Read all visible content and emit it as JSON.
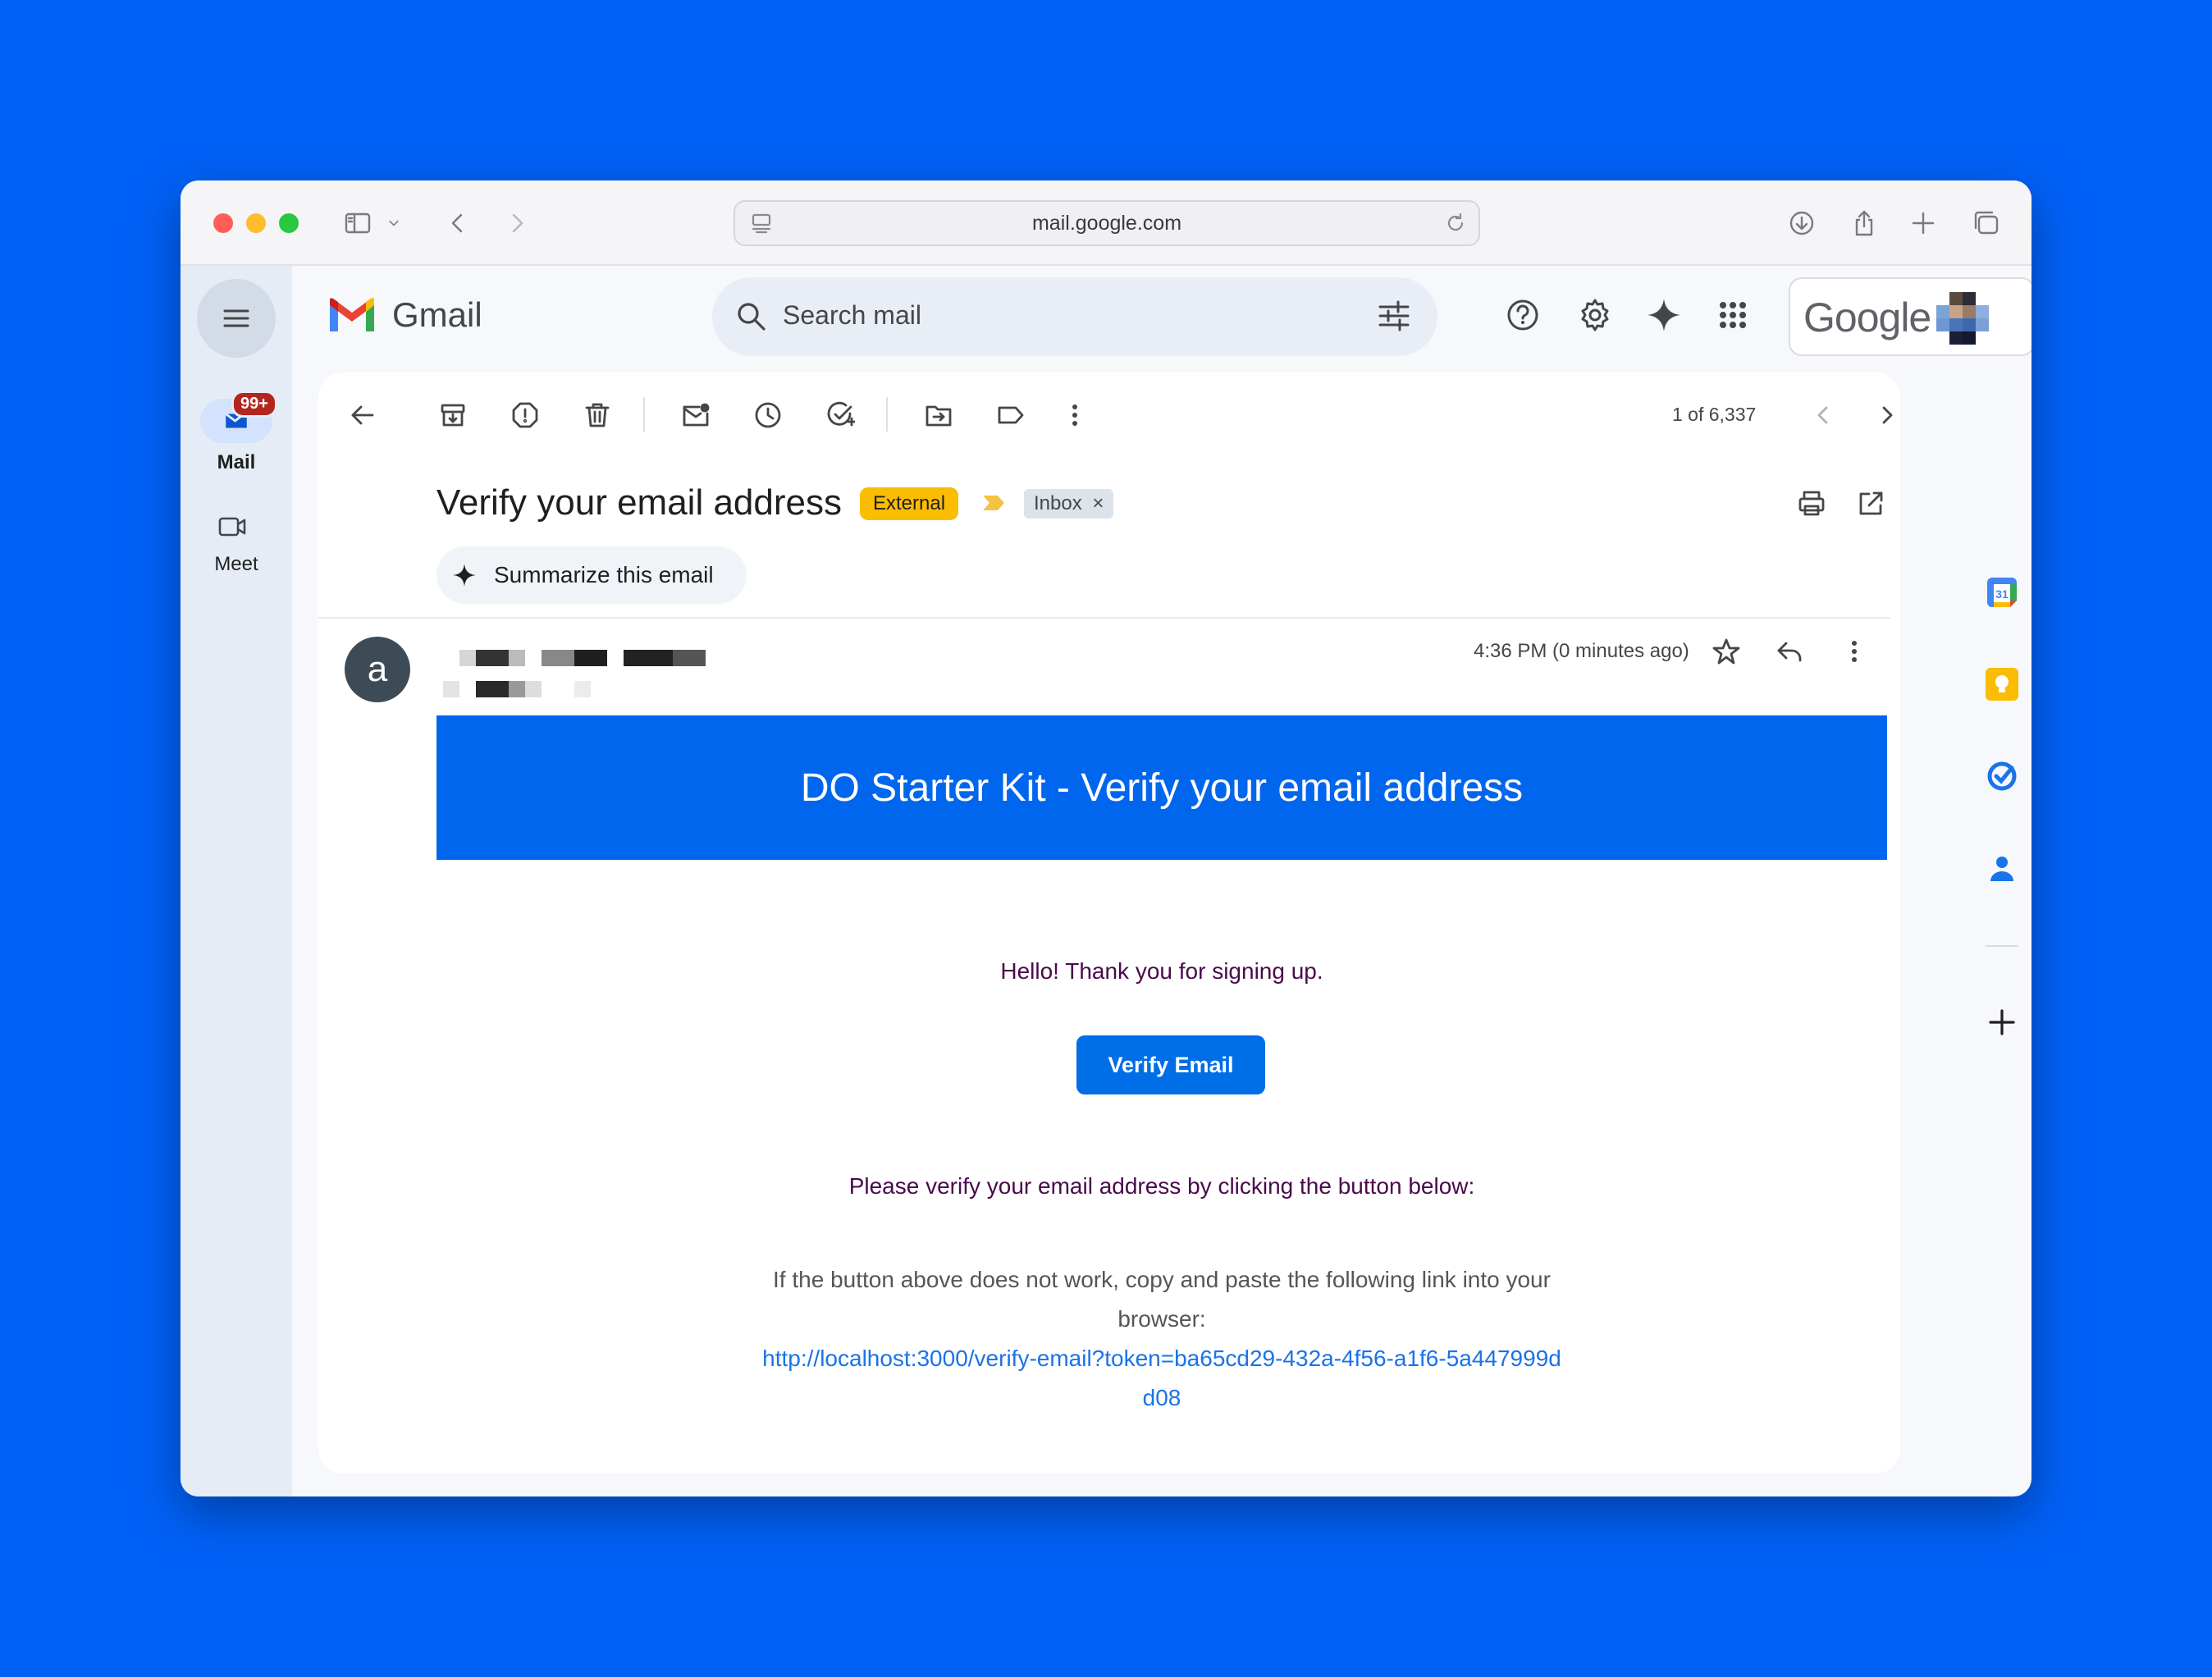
{
  "browser": {
    "url": "mail.google.com",
    "colors": {
      "close": "#ff5f57",
      "minimize": "#febc2e",
      "maximize": "#28c840"
    }
  },
  "rail": {
    "mail_label": "Mail",
    "mail_badge": "99+",
    "meet_label": "Meet"
  },
  "header": {
    "app_name": "Gmail",
    "search_placeholder": "Search mail",
    "account_brand": "Google"
  },
  "toolbar": {
    "pager": "1 of 6,337",
    "icons": [
      "back-arrow-icon",
      "archive-icon",
      "report-spam-icon",
      "delete-icon",
      "mark-unread-icon",
      "snooze-icon",
      "add-to-tasks-icon",
      "move-to-icon",
      "label-icon",
      "more-vert-icon"
    ]
  },
  "message": {
    "subject": "Verify your email address",
    "external_chip": "External",
    "inbox_chip": "Inbox",
    "summarize_label": "Summarize this email",
    "sender_initial": "a",
    "time": "4:36 PM (0 minutes ago)"
  },
  "email_body": {
    "banner_title": "DO Starter Kit - Verify your email address",
    "greeting": "Hello! Thank you for signing up.",
    "button_label": "Verify Email",
    "instruction": "Please verify your email address by clicking the button below:",
    "fallback_text": "If the button above does not work, copy and paste the following link into your browser:",
    "link": "http://localhost:3000/verify-email?token=ba65cd29-432a-4f56-a1f6-5a447999dd08",
    "colors": {
      "banner": "#0066ee",
      "button": "#006ee6",
      "text": "#4a0a4a",
      "link": "#1a73e8"
    }
  }
}
